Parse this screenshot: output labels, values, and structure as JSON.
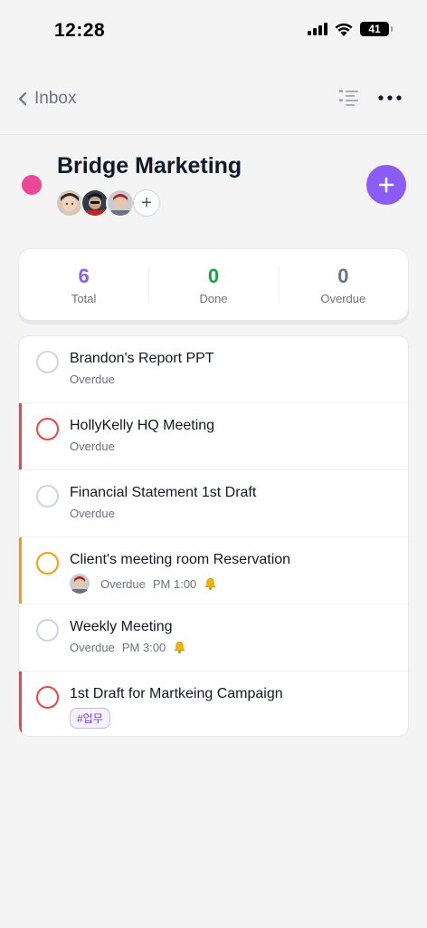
{
  "status_bar": {
    "time": "12:28",
    "battery": "41"
  },
  "nav": {
    "back_label": "Inbox"
  },
  "project": {
    "title": "Bridge Marketing",
    "color": "#ec4899",
    "add_member_symbol": "+"
  },
  "stats": [
    {
      "value": "6",
      "label": "Total",
      "color": "#8b5cf6"
    },
    {
      "value": "0",
      "label": "Done",
      "color": "#16a34a"
    },
    {
      "value": "0",
      "label": "Overdue",
      "color": "#6b7280"
    }
  ],
  "tasks": [
    {
      "title": "Brandon's Report PPT",
      "status": "Overdue",
      "time": "",
      "tag": "",
      "priority_color": "",
      "check_color": "#d1d5db"
    },
    {
      "title": "HollyKelly HQ Meeting",
      "status": "Overdue",
      "time": "",
      "tag": "",
      "priority_color": "#ef4444",
      "check_color": "#ef4444"
    },
    {
      "title": "Financial Statement 1st Draft",
      "status": "Overdue",
      "time": "",
      "tag": "",
      "priority_color": "",
      "check_color": "#d1d5db"
    },
    {
      "title": "Client's meeting room Reservation",
      "status": "Overdue",
      "time": "PM 1:00",
      "tag": "",
      "priority_color": "#f59e0b",
      "check_color": "#f59e0b"
    },
    {
      "title": "Weekly Meeting",
      "status": "Overdue",
      "time": "PM 3:00",
      "tag": "",
      "priority_color": "",
      "check_color": "#d1d5db"
    },
    {
      "title": "1st Draft for Martkeing Campaign",
      "status": "",
      "time": "",
      "tag": "#업무",
      "priority_color": "#ef4444",
      "check_color": "#ef4444"
    }
  ]
}
